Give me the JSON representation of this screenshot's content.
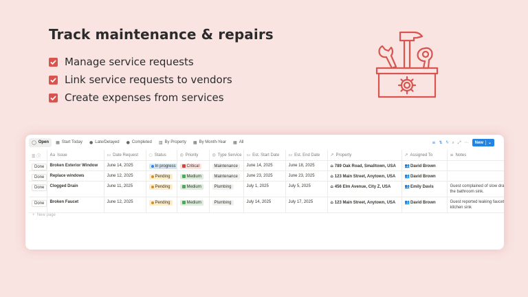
{
  "hero": {
    "title": "Track maintenance & repairs",
    "features": [
      "Manage service requests",
      "Link service requests to vendors",
      "Create expenses from services"
    ],
    "accent": "#d9534f"
  },
  "views": [
    {
      "label": "Open",
      "icon": "circle-icon",
      "glyph": "◯",
      "active": true
    },
    {
      "label": "Start Today",
      "icon": "table-icon",
      "glyph": "▦",
      "active": false
    },
    {
      "label": "Late/Delayed",
      "icon": "alert-icon",
      "glyph": "●",
      "active": false
    },
    {
      "label": "Completed",
      "icon": "check-circle-icon",
      "glyph": "●",
      "active": false
    },
    {
      "label": "By Property",
      "icon": "board-icon",
      "glyph": "▥",
      "active": false
    },
    {
      "label": "By Month-Year",
      "icon": "table-icon",
      "glyph": "▦",
      "active": false
    },
    {
      "label": "All",
      "icon": "table-icon",
      "glyph": "▦",
      "active": false
    }
  ],
  "toolbar": {
    "new_label": "New",
    "new_color": "#2383e2"
  },
  "columns": [
    {
      "label": "",
      "icon": "settings-icon",
      "glyph": "☰ ⓘ"
    },
    {
      "label": "Issue",
      "icon": "title-icon",
      "glyph": "Aa"
    },
    {
      "label": "Date Request",
      "icon": "calendar-icon",
      "glyph": "▭"
    },
    {
      "label": "Status",
      "icon": "status-icon",
      "glyph": "◌"
    },
    {
      "label": "Priority",
      "icon": "select-icon",
      "glyph": "◎"
    },
    {
      "label": "Type Service",
      "icon": "select-icon",
      "glyph": "◎"
    },
    {
      "label": "Est. Start Date",
      "icon": "calendar-icon",
      "glyph": "▭"
    },
    {
      "label": "Est. End Date",
      "icon": "calendar-icon",
      "glyph": "▭"
    },
    {
      "label": "Property",
      "icon": "relation-icon",
      "glyph": "↗"
    },
    {
      "label": "Assigned To",
      "icon": "relation-icon",
      "glyph": "↗"
    },
    {
      "label": "Notes",
      "icon": "text-icon",
      "glyph": "≡"
    }
  ],
  "rows": [
    {
      "action": "Done",
      "issue": "Broken Exterior Window",
      "date_request": "June 14, 2025",
      "status": "In progress",
      "status_color": "#d3e5ef",
      "status_dot": "#2f80ed",
      "priority": "Critical",
      "priority_bg": "#ffe2dd",
      "priority_sq": "#e03e3e",
      "type_service": "Maintenance",
      "type_bg": "#f1f1ef",
      "start": "June 14, 2025",
      "end": "June 18, 2025",
      "property": "789 Oak Road, Smalltown, USA",
      "assigned": "David Brown",
      "notes": ""
    },
    {
      "action": "Done",
      "issue": "Replace windows",
      "date_request": "June 12, 2025",
      "status": "Pending",
      "status_color": "#fdecc8",
      "status_dot": "#cb912f",
      "priority": "Medium",
      "priority_bg": "#dbeddb",
      "priority_sq": "#4daa57",
      "type_service": "Maintenance",
      "type_bg": "#f1f1ef",
      "start": "June 23, 2025",
      "end": "June 23, 2025",
      "property": "123 Main Street, Anytown, USA",
      "assigned": "David Brown",
      "notes": ""
    },
    {
      "action": "Done",
      "issue": "Clogged Drain",
      "date_request": "June 11, 2025",
      "status": "Pending",
      "status_color": "#fdecc8",
      "status_dot": "#cb912f",
      "priority": "Medium",
      "priority_bg": "#dbeddb",
      "priority_sq": "#4daa57",
      "type_service": "Plumbing",
      "type_bg": "#f1f1ef",
      "start": "July 1, 2025",
      "end": "July 5, 2025",
      "property": "456 Elm Avenue, City Z, USA",
      "assigned": "Emily Davis",
      "notes": "Guest complained of slow drainage in the bathroom sink."
    },
    {
      "action": "Done",
      "issue": "Broken Faucet",
      "date_request": "June 12, 2025",
      "status": "Pending",
      "status_color": "#fdecc8",
      "status_dot": "#cb912f",
      "priority": "Medium",
      "priority_bg": "#dbeddb",
      "priority_sq": "#4daa57",
      "type_service": "Plumbing",
      "type_bg": "#f1f1ef",
      "start": "July 14, 2025",
      "end": "July 17, 2025",
      "property": "123 Main Street, Anytown, USA",
      "assigned": "David Brown",
      "notes": "Guest reported leaking faucet in the kitchen sink"
    }
  ],
  "new_page_label": "New page"
}
